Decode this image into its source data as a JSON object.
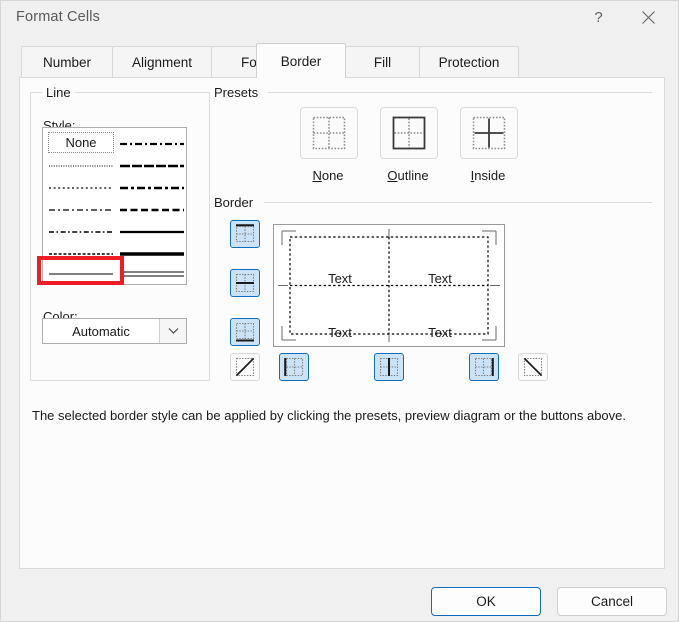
{
  "window": {
    "title": "Format Cells",
    "help_icon": "question-mark-icon",
    "help_label": "?",
    "close_icon": "close-icon"
  },
  "tabs": [
    {
      "label": "Number",
      "active": false
    },
    {
      "label": "Alignment",
      "active": false
    },
    {
      "label": "Font",
      "active": false
    },
    {
      "label": "Border",
      "active": true
    },
    {
      "label": "Fill",
      "active": false
    },
    {
      "label": "Protection",
      "active": false
    }
  ],
  "line_group": {
    "title": "Line",
    "style_label": "Style:",
    "style_accel": "S",
    "none_option": "None",
    "styles": [
      {
        "col": 0,
        "row": 0,
        "name": "none",
        "selected": false
      },
      {
        "col": 0,
        "row": 1,
        "name": "fine-dotted",
        "selected": false
      },
      {
        "col": 0,
        "row": 2,
        "name": "dotted",
        "selected": false
      },
      {
        "col": 0,
        "row": 3,
        "name": "dash-dot-sparse",
        "selected": false
      },
      {
        "col": 0,
        "row": 4,
        "name": "dash-dot",
        "selected": false
      },
      {
        "col": 0,
        "row": 5,
        "name": "dashed-fine",
        "selected": false
      },
      {
        "col": 0,
        "row": 6,
        "name": "thin-solid",
        "selected": true
      },
      {
        "col": 1,
        "row": 0,
        "name": "thick-dash-dot",
        "selected": false
      },
      {
        "col": 1,
        "row": 1,
        "name": "thick-dash-long",
        "selected": false
      },
      {
        "col": 1,
        "row": 2,
        "name": "thick-dash-dot-heavy",
        "selected": false
      },
      {
        "col": 1,
        "row": 3,
        "name": "thick-dashed",
        "selected": false
      },
      {
        "col": 1,
        "row": 4,
        "name": "medium-solid",
        "selected": false
      },
      {
        "col": 1,
        "row": 5,
        "name": "thick-solid",
        "selected": false
      },
      {
        "col": 1,
        "row": 6,
        "name": "double-line",
        "selected": false
      }
    ],
    "highlight": {
      "around": "thin-solid",
      "color": "#ee1d23"
    },
    "color_label": "Color:",
    "color_accel": "C",
    "color_value": "Automatic",
    "color_dropdown_icon": "chevron-down-icon"
  },
  "presets_group": {
    "title": "Presets",
    "items": [
      {
        "label": "None",
        "accel": "N",
        "icon": "preset-none-icon",
        "pressed": false
      },
      {
        "label": "Outline",
        "accel": "O",
        "icon": "preset-outline-icon",
        "pressed": false
      },
      {
        "label": "Inside",
        "accel": "I",
        "icon": "preset-inside-icon",
        "pressed": false
      }
    ]
  },
  "border_group": {
    "title": "Border",
    "preview_cells": [
      "Text",
      "Text",
      "Text",
      "Text"
    ],
    "side_buttons": [
      {
        "name": "border-top-button",
        "icon": "border-top-icon",
        "pressed": true
      },
      {
        "name": "border-horizontal-button",
        "icon": "border-horizontal-icon",
        "pressed": true
      },
      {
        "name": "border-bottom-button",
        "icon": "border-bottom-icon",
        "pressed": true
      }
    ],
    "bottom_buttons": [
      {
        "name": "border-diagonal-up-button",
        "icon": "border-diagonal-up-icon",
        "pressed": false
      },
      {
        "name": "border-left-button",
        "icon": "border-left-icon",
        "pressed": true
      },
      {
        "name": "border-vertical-button",
        "icon": "border-vertical-icon",
        "pressed": true
      },
      {
        "name": "border-right-button",
        "icon": "border-right-icon",
        "pressed": true
      },
      {
        "name": "border-diagonal-down-button",
        "icon": "border-diagonal-down-icon",
        "pressed": false
      }
    ]
  },
  "hint": "The selected border style can be applied by clicking the presets, preview diagram or the buttons above.",
  "footer": {
    "ok_label": "OK",
    "cancel_label": "Cancel",
    "default_button": "OK"
  },
  "colors": {
    "accent": "#0f6cbd",
    "toggle_on_bg": "#cce2f7",
    "highlight": "#ee1d23",
    "dialog_bg": "#f0f0f0",
    "panel_bg": "#fcfcfc"
  }
}
